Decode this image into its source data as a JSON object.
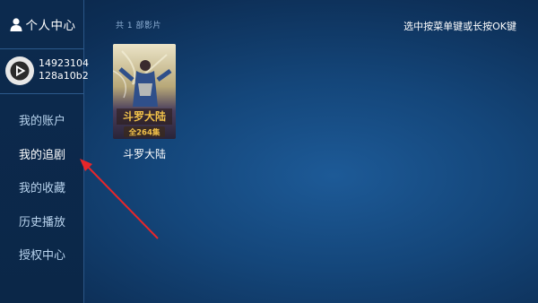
{
  "sidebar": {
    "title": "个人中心",
    "user_id_line1": "14923104",
    "user_id_line2": "128a10b2",
    "items": [
      {
        "label": "我的账户"
      },
      {
        "label": "我的追剧"
      },
      {
        "label": "我的收藏"
      },
      {
        "label": "历史播放"
      },
      {
        "label": "授权中心"
      }
    ]
  },
  "main": {
    "count_label": "共 1 部影片",
    "hint": "选中按菜单键或长按OK键",
    "items": [
      {
        "title": "斗罗大陆",
        "poster_text": "斗罗大陆",
        "poster_episodes": "全264集"
      }
    ]
  },
  "colors": {
    "background": "#14467a",
    "sidebar": "#0c2a4e",
    "menu_text": "#b9d4ee",
    "arrow": "#e8262a"
  },
  "icons": {
    "header": "person-icon",
    "avatar": "play-logo-icon"
  }
}
